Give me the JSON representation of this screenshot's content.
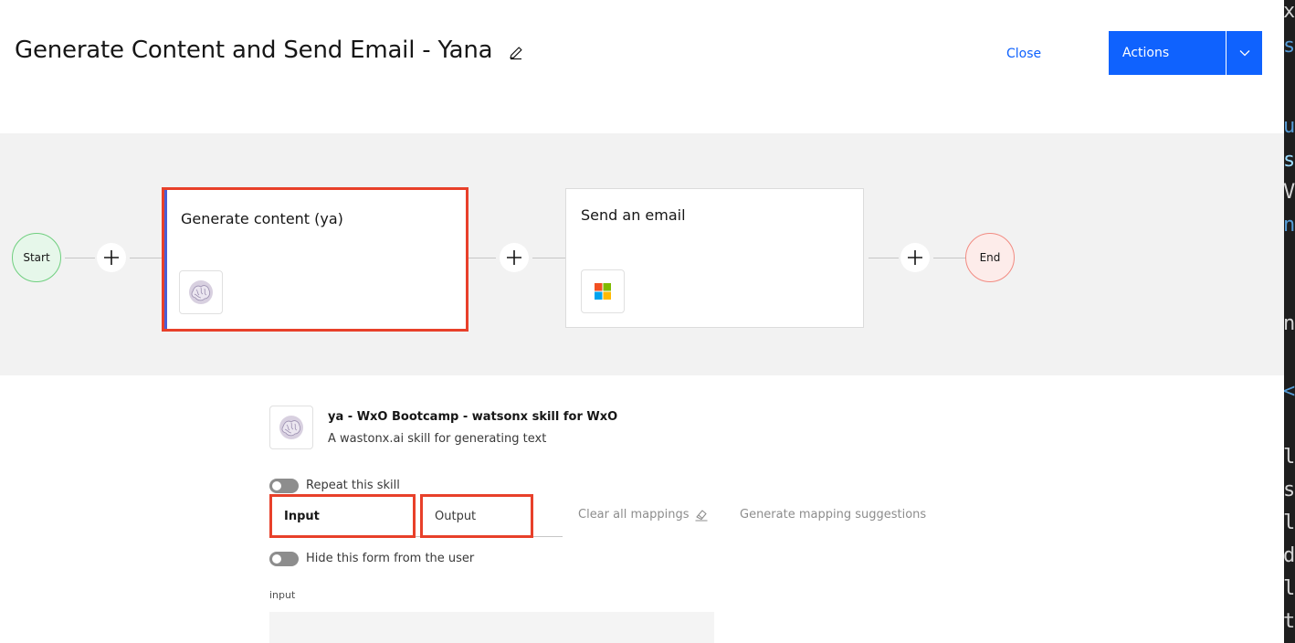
{
  "header": {
    "title": "Generate Content and Send Email - Yana",
    "close_label": "Close",
    "actions_label": "Actions"
  },
  "flow": {
    "start_label": "Start",
    "end_label": "End",
    "steps": [
      {
        "title": "Generate content (ya)",
        "icon": "brain-icon",
        "selected": true
      },
      {
        "title": "Send an email",
        "icon": "microsoft-logo-icon",
        "selected": false
      }
    ]
  },
  "skill": {
    "name": "ya - WxO Bootcamp - watsonx skill for WxO",
    "description": "A wastonx.ai skill for generating text",
    "repeat_label": "Repeat this skill",
    "repeat_enabled": false
  },
  "mapping": {
    "tabs": [
      {
        "label": "Input",
        "active": true
      },
      {
        "label": "Output",
        "active": false
      }
    ],
    "clear_label": "Clear all mappings",
    "generate_label": "Generate mapping suggestions",
    "hide_form_label": "Hide this form from the user",
    "hide_form_enabled": false,
    "field_label": "input",
    "field_value": ""
  },
  "colors": {
    "primary": "#0f62fe",
    "highlight": "#e8402a",
    "start_fill": "#e6f7ea",
    "end_fill": "#fdecea"
  }
}
